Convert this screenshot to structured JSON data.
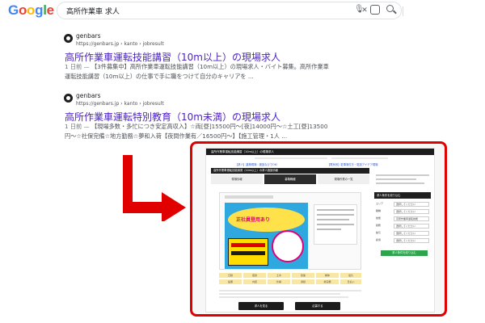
{
  "logo": {
    "text": "Google",
    "letters": [
      {
        "ch": "G",
        "color": "#4285F4"
      },
      {
        "ch": "o",
        "color": "#EA4335"
      },
      {
        "ch": "o",
        "color": "#FBBC05"
      },
      {
        "ch": "g",
        "color": "#4285F4"
      },
      {
        "ch": "l",
        "color": "#34A853"
      },
      {
        "ch": "e",
        "color": "#EA4335"
      }
    ]
  },
  "search": {
    "query": "高所作業車 求人",
    "icons": [
      "close-icon",
      "mic-icon",
      "lens-icon",
      "search-icon"
    ]
  },
  "results": [
    {
      "site": "genbars",
      "url": "https://genbars.jp › kanto › jobresult",
      "title": "高所作業車運転技能講習（10m以上）の現場求人",
      "date": "1 日前 —",
      "snippet": "【3件募集中】高所作業車運転技能講習（10m以上）の現場求人・バイト募集。高所作業車運転技能講習（10m以上）の仕事で手に職をつけて自分のキャリアを ..."
    },
    {
      "site": "genbars",
      "url": "https://genbars.jp › kanto › jobresult",
      "title": "高所作業車運転特別教育（10m未満）の現場求人",
      "date": "1 日前 —",
      "snippet": "【現場多数・多忙につき安定高収入】☆両[昼]15500円〜[夜]14000円〜☆土工[昼]13500円〜☆社保完備☆地方勤務☆夢和入荷【夜間作業有／16500円〜】【施工管理・1人 ..."
    }
  ],
  "preview": {
    "header": "高所作業車運転技能講習（10m以上）の現場求人",
    "link_left": "【求人】建築現場・施設なびでOK!",
    "link_right": "【電気系】駐車場付き・駐設アイデア現場",
    "dark_row": "高所作業車運転技能講習（10m以上）の求人施設情報",
    "tabs": [
      "現場情報",
      "募集職種",
      "現場作業の一覧"
    ],
    "side_head": "求人条件を絞り込む",
    "side_labels": [
      "エリア",
      "職種",
      "技能",
      "勤務",
      "給与",
      "雇用"
    ],
    "side_values": [
      "選択してください",
      "選択してください",
      "高所作業車運転技能",
      "選択してください",
      "選択してください",
      "選択してください"
    ],
    "green_button": "求人条件を絞り込む",
    "grid_cells": [
      "日勤",
      "夜勤",
      "土木",
      "建築",
      "解体",
      "電気",
      "設備",
      "内装",
      "外構",
      "通勤",
      "寮完備",
      "日払い"
    ],
    "buttons": [
      "求人を見る",
      "応募する"
    ],
    "banner_text": "正社員登用あり"
  },
  "colors": {
    "accent_red": "#e00000",
    "link_purple": "#4b1fc7",
    "banner_blue": "#2fa7df"
  }
}
